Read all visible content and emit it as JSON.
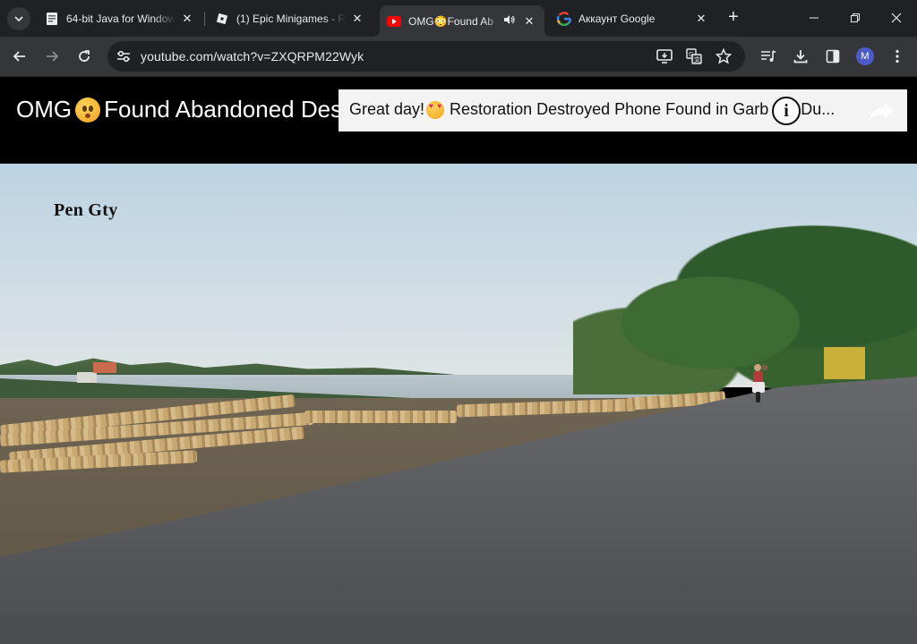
{
  "browser": {
    "tabs": [
      {
        "title": "64-bit Java for Window",
        "favicon": "java-icon"
      },
      {
        "title": "(1) Epic Minigames - R",
        "favicon": "roblox-icon"
      },
      {
        "title": "OMG😳Found Ab",
        "favicon": "youtube-icon",
        "active": true,
        "audio": true
      },
      {
        "title": "Аккаунт Google",
        "favicon": "google-icon"
      }
    ],
    "address": "youtube.com/watch?v=ZXQRPM22Wyk",
    "avatar_letter": "M",
    "avatar_color": "#4c5cc7"
  },
  "video": {
    "title": "OMG",
    "title_rest": "Found Abandoned Des",
    "watermark": "Pen Gty",
    "next_card": {
      "text_before": "Great day!",
      "text_after": "Restoration Destroyed Phone Found in Garb",
      "text_tail": "Du..."
    }
  },
  "colors": {
    "tab_bar": "#202124",
    "toolbar": "#35363a",
    "youtube_red": "#ff0000"
  }
}
